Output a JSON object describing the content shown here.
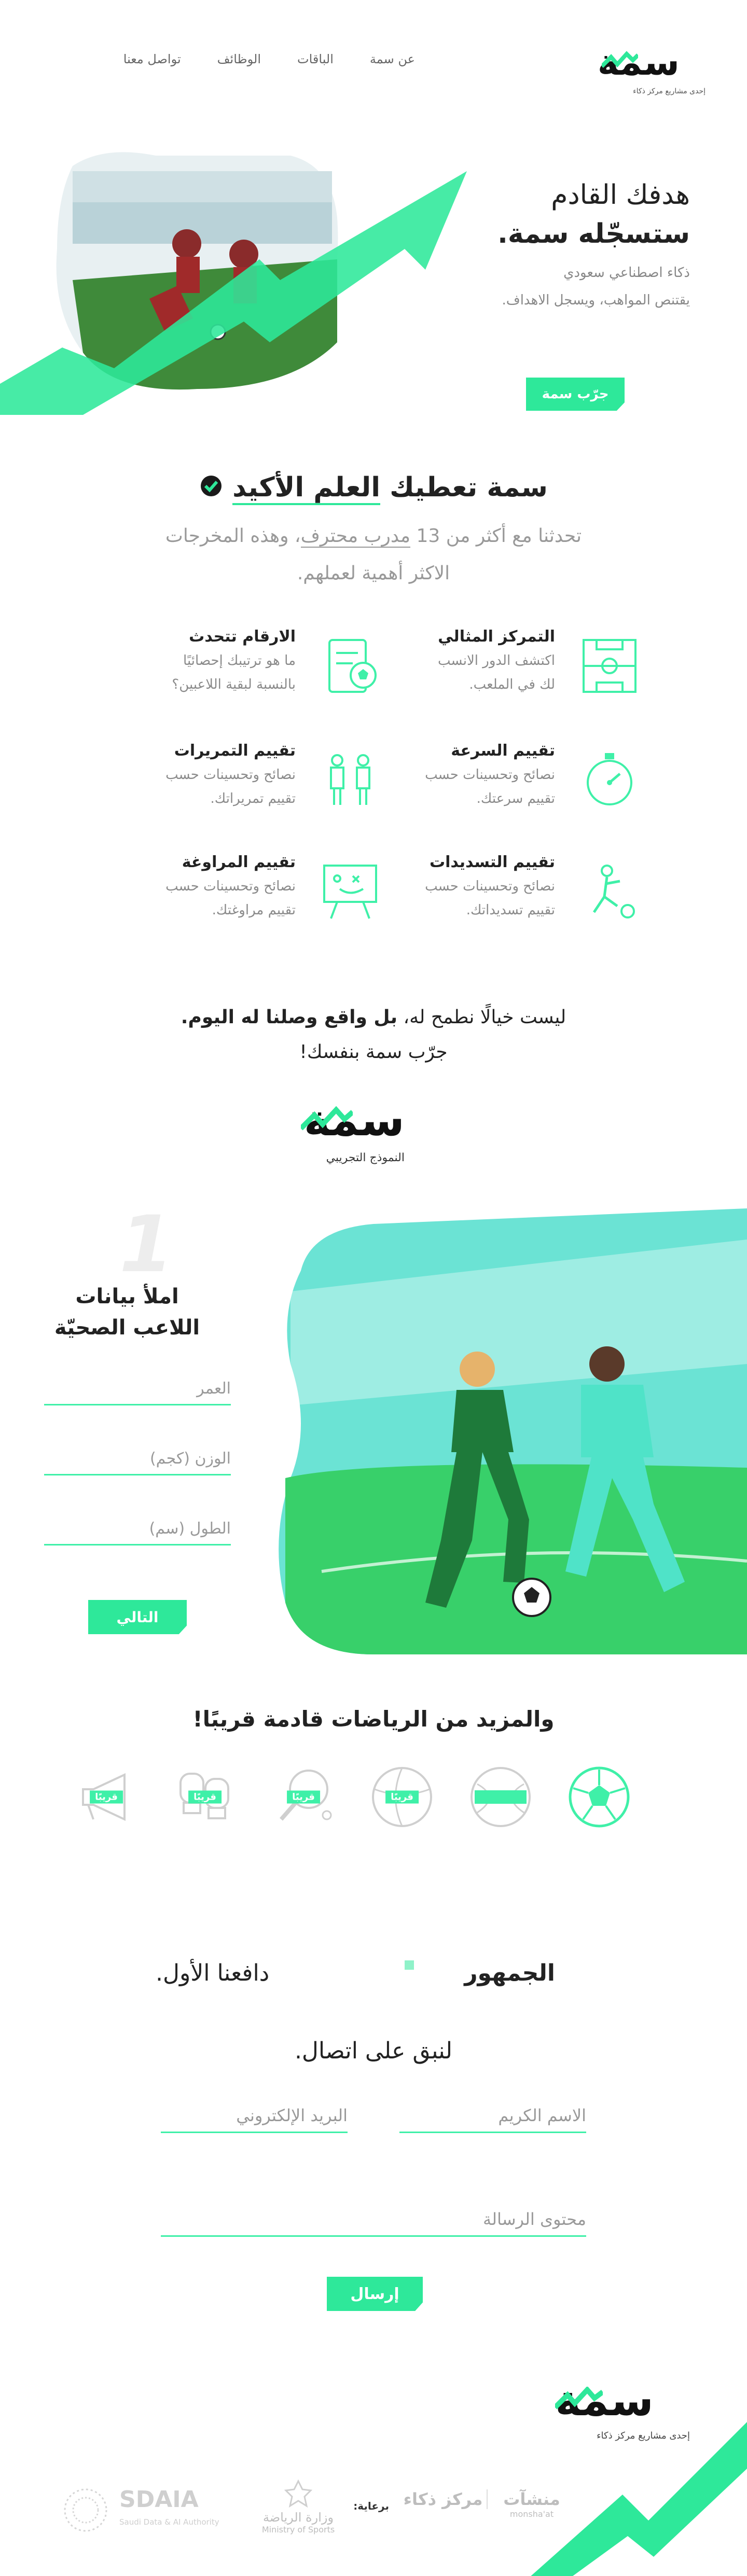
{
  "brand": {
    "logo_text": "سمة",
    "tagline": "إحدى مشاريع مركز ذكاء"
  },
  "nav": {
    "items": [
      "عن سمة",
      "الباقات",
      "الوظائف",
      "تواصل معنا"
    ]
  },
  "hero": {
    "title_line1": "هدفك القادم",
    "title_line2": "ستسجّله سمة.",
    "desc_line1": "ذكاء اصطناعي سعودي",
    "desc_line2": "يقتنص المواهب، ويسجل الاهداف.",
    "cta": "جرّب سمة"
  },
  "science": {
    "title_prefix": "سمة تعطيك",
    "title_highlight": "العلم الأكيد",
    "desc_part1": "تحدثنا مع أكثر من 13",
    "desc_link": "مدرب محترف",
    "desc_part2": "، وهذه المخرجات",
    "desc_line2": "الاكثر أهمية لعملهم."
  },
  "features": [
    {
      "title": "التمركز المثالي",
      "desc1": "اكتشف الدور الانسب",
      "desc2": "لك في الملعب.",
      "icon": "field-icon"
    },
    {
      "title": "الارقام تتحدث",
      "desc1": "ما هو ترتيبك إحصائيًا",
      "desc2": "بالنسبة لبقية اللاعبين؟",
      "icon": "stats-clipboard-icon"
    },
    {
      "title": "تقييم السرعة",
      "desc1": "نصائح وتحسينات حسب",
      "desc2": "تقييم سرعتك.",
      "icon": "stopwatch-icon"
    },
    {
      "title": "تقييم التمريرات",
      "desc1": "نصائح وتحسينات حسب",
      "desc2": "تقييم تمريراتك.",
      "icon": "passing-players-icon"
    },
    {
      "title": "تقييم التسديدات",
      "desc1": "نصائح وتحسينات حسب",
      "desc2": "تقييم تسديداتك.",
      "icon": "shooting-player-icon"
    },
    {
      "title": "تقييم المراوغة",
      "desc1": "نصائح وتحسينات حسب",
      "desc2": "تقييم مراوغتك.",
      "icon": "tactics-board-icon"
    }
  ],
  "dream": {
    "line1_part1": "ليست خيالًا نطمح له،",
    "line1_bold": "بل واقع وصلنا له اليوم.",
    "line2": "جرّب سمة بنفسك!"
  },
  "trial": {
    "logo_text": "سمة",
    "label": "النموذج التجريبي",
    "step_number": "1",
    "form_title_line1": "املأ بيانات",
    "form_title_line2": "اللاعب الصحيّة",
    "fields": [
      "العمر",
      "الوزن (كجم)",
      "الطول (سم)"
    ],
    "next_button": "التالي"
  },
  "more_sports": {
    "title": "والمزيد من الرياضات قادمة قريبًا!",
    "soon_badge": "قريبًا",
    "sports": [
      "football-icon",
      "tennis-ball-icon",
      "volleyball-icon",
      "table-tennis-icon",
      "boxing-gloves-icon",
      "horn-icon"
    ]
  },
  "audience": {
    "word1": "الجمهور",
    "word2": "دافعنا الأول."
  },
  "contact": {
    "title": "لنبق على اتصال.",
    "name_placeholder": "الاسم الكريم",
    "email_placeholder": "البريد الإلكتروني",
    "message_placeholder": "محتوى الرسالة",
    "submit": "إرسال"
  },
  "footer": {
    "logo_text": "سمة",
    "tagline": "إحدى مشاريع مركز ذكاء",
    "sponsors_label": "برعاية:",
    "sponsors": [
      {
        "name": "منشآت",
        "sub": "monsha'at"
      },
      {
        "name": "مركز ذكاء",
        "sub": ""
      },
      {
        "name": "وزارة الرياضة",
        "sub": "Ministry of Sports"
      },
      {
        "name": "SDAIA",
        "sub": "Saudi Data & AI Authority"
      }
    ]
  },
  "colors": {
    "accent": "#2ee89a",
    "accent_light": "#3ff0a8",
    "text_dark": "#222222",
    "text_muted": "#8a8a8a"
  }
}
